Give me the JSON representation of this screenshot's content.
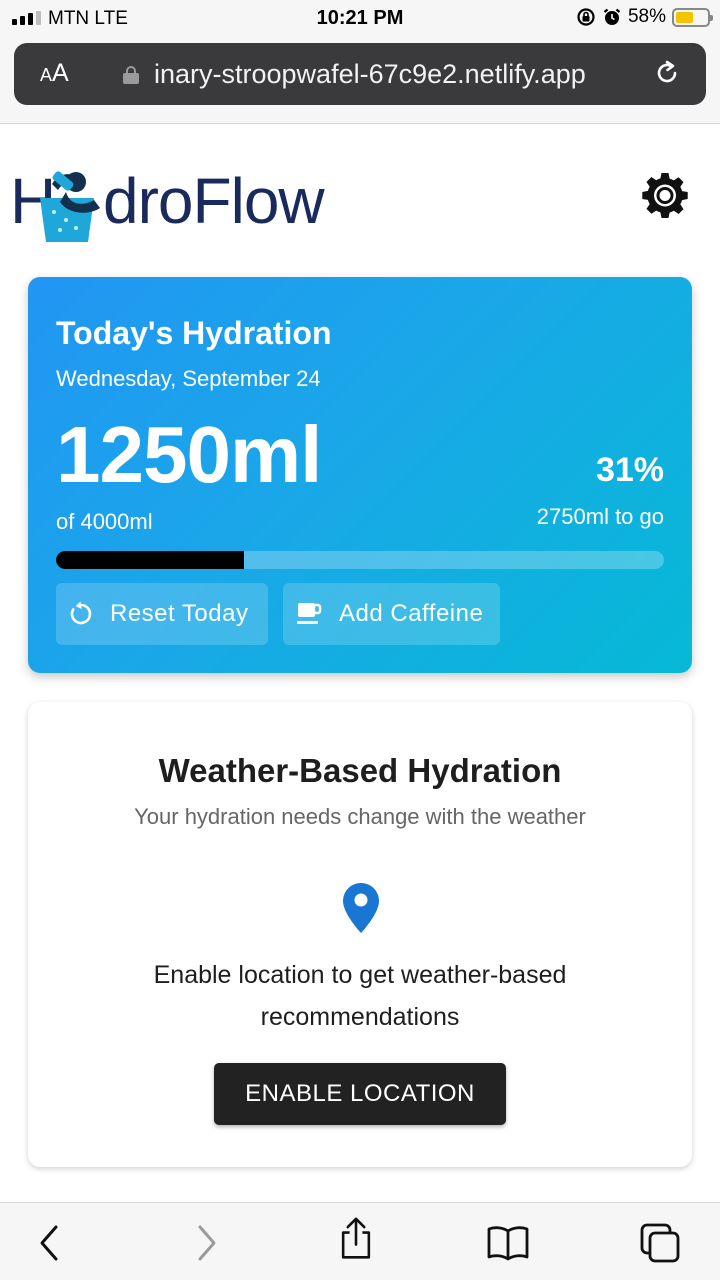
{
  "status_bar": {
    "carrier": "MTN  LTE",
    "time": "10:21 PM",
    "battery_percent": "58%",
    "battery_level": 0.58,
    "icons": [
      "signal-icon",
      "rotation-lock-icon",
      "alarm-icon",
      "battery-icon"
    ]
  },
  "browser": {
    "aa_label": "AA",
    "url": "inary-stroopwafel-67c9e2.netlify.app",
    "icons": [
      "lock-icon",
      "reload-icon"
    ]
  },
  "header": {
    "logo_prefix": "H",
    "logo_text": "droFlow",
    "icons": [
      "drinking-figure-logo-icon",
      "gear-icon"
    ]
  },
  "hydration": {
    "title": "Today's Hydration",
    "date": "Wednesday, September 24",
    "amount": "1250ml",
    "goal": "of 4000ml",
    "percent": "31%",
    "remaining": "2750ml to go",
    "progress_fraction": 0.31,
    "buttons": {
      "reset": "Reset Today",
      "caffeine": "Add Caffeine"
    },
    "colors": {
      "gradient_start": "#2196f3",
      "gradient_end": "#06b9d6",
      "progress_fill": "#000000"
    }
  },
  "weather": {
    "title": "Weather-Based Hydration",
    "subtitle": "Your hydration needs change with the weather",
    "message": "Enable location to get weather-based recommendations",
    "button": "ENABLE LOCATION",
    "accent": "#1976d2"
  },
  "toolbar": {
    "icons": [
      "back-icon",
      "forward-icon",
      "share-icon",
      "bookmarks-icon",
      "tabs-icon"
    ]
  }
}
